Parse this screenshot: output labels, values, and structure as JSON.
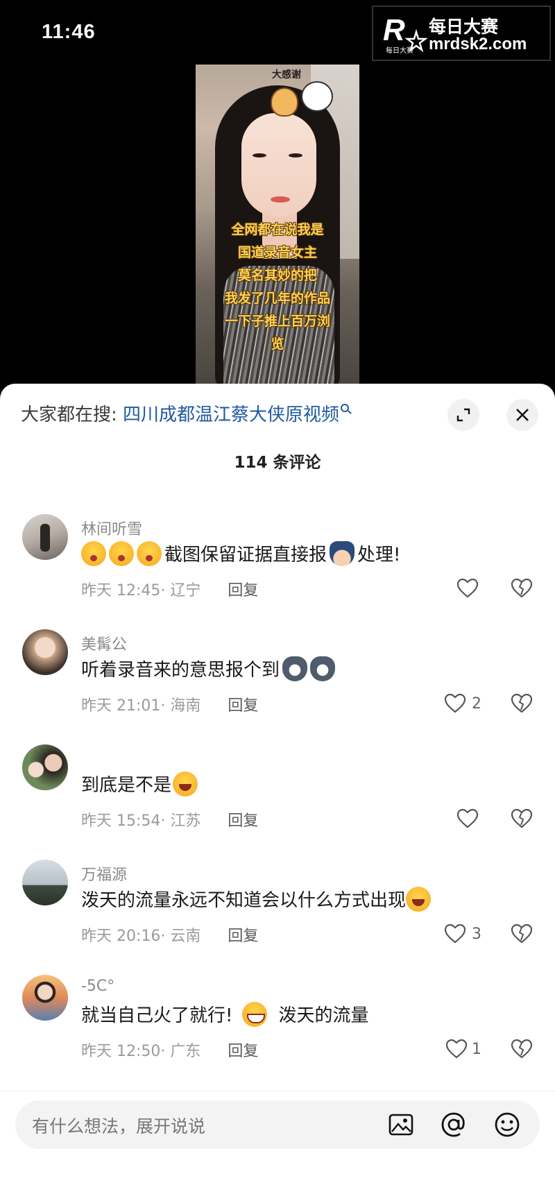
{
  "status_bar": {
    "time": "11:46"
  },
  "watermark": {
    "logo_letter": "R",
    "logo_sub": "每日大赛",
    "name": "每日大赛",
    "url": "mrdsk2.com"
  },
  "video": {
    "sticker_label": "大感谢",
    "caption_lines": [
      "全网都在说我是",
      "国道录音女主",
      "莫名其妙的把",
      "我发了几年的作品",
      "一下子推上百万浏",
      "览"
    ]
  },
  "sheet": {
    "search_prefix": "大家都在搜:",
    "search_term": "四川成都温江蔡大侠原视频",
    "comment_count": "114 条评论",
    "reply_label": "回复"
  },
  "comments": [
    {
      "username": "林间听雪",
      "text": "截图保留证据直接报",
      "text_after": "处理!",
      "time": "昨天 12:45",
      "location": "辽宁",
      "likes": ""
    },
    {
      "username": "美髯公",
      "text": "听着录音来的意思报个到",
      "time": "昨天 21:01",
      "location": "海南",
      "likes": "2"
    },
    {
      "username": "",
      "text": "到底是不是",
      "time": "昨天 15:54",
      "location": "江苏",
      "likes": ""
    },
    {
      "username": "万福源",
      "text": "泼天的流量永远不知道会以什么方式出现",
      "time": "昨天 20:16",
      "location": "云南",
      "likes": "3"
    },
    {
      "username": "-5C°",
      "text": "就当自己火了就行!",
      "text_after": "泼天的流量",
      "time": "昨天 12:50",
      "location": "广东",
      "likes": "1"
    }
  ],
  "input": {
    "placeholder": "有什么想法，展开说说"
  },
  "icons": {
    "expand": "expand-icon",
    "close": "close-icon",
    "heart": "heart-icon",
    "broken_heart": "broken-heart-icon",
    "image": "image-icon",
    "at": "at-icon",
    "emoji": "emoji-icon"
  }
}
